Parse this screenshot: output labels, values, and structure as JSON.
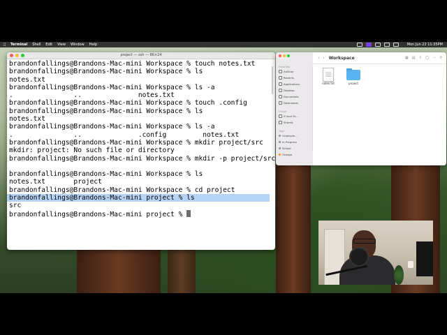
{
  "menubar": {
    "app_name": "Terminal",
    "items": [
      "Shell",
      "Edit",
      "View",
      "Window",
      "Help"
    ],
    "clock": "Mon Jun 22  11:35PM"
  },
  "terminal": {
    "title": "project — zsh — 86×24",
    "lines": [
      "brandonfallings@Brandons-Mac-mini Workspace % touch notes.txt",
      "brandonfallings@Brandons-Mac-mini Workspace % ls",
      "notes.txt",
      "brandonfallings@Brandons-Mac-mini Workspace % ls -a",
      ".               ..              notes.txt",
      "brandonfallings@Brandons-Mac-mini Workspace % touch .config",
      "brandonfallings@Brandons-Mac-mini Workspace % ls",
      "notes.txt",
      "brandonfallings@Brandons-Mac-mini Workspace % ls -a",
      ".               ..              .config         notes.txt",
      "brandonfallings@Brandons-Mac-mini Workspace % mkdir project/src",
      "mkdir: project: No such file or directory",
      "brandonfallings@Brandons-Mac-mini Workspace % mkdir -p project/src",
      "",
      "brandonfallings@Brandons-Mac-mini Workspace % ls",
      "notes.txt       project",
      "brandonfallings@Brandons-Mac-mini Workspace % cd project",
      "brandonfallings@Brandons-Mac-mini project % ls",
      "src"
    ],
    "prompt": "brandonfallings@Brandons-Mac-mini project % "
  },
  "finder": {
    "title": "Workspace",
    "sidebar": {
      "favorites_header": "Favorites",
      "favorites": [
        "AirDrop",
        "Recents",
        "Applications",
        "Desktop",
        "Documents",
        "Downloads"
      ],
      "icloud_header": "iCloud",
      "icloud": [
        "iCloud Dr...",
        "Shared"
      ],
      "tags_header": "Tags",
      "tags": [
        {
          "label": "Gratitude...",
          "color": "#8e8e93"
        },
        {
          "label": "In Progress",
          "color": "#8e8e93"
        },
        {
          "label": "School",
          "color": "#8e8e93"
        },
        {
          "label": "Orange",
          "color": "#ff9500"
        }
      ]
    },
    "files": [
      {
        "name": "notes.txt",
        "kind": "document"
      },
      {
        "name": "project",
        "kind": "folder"
      }
    ]
  }
}
